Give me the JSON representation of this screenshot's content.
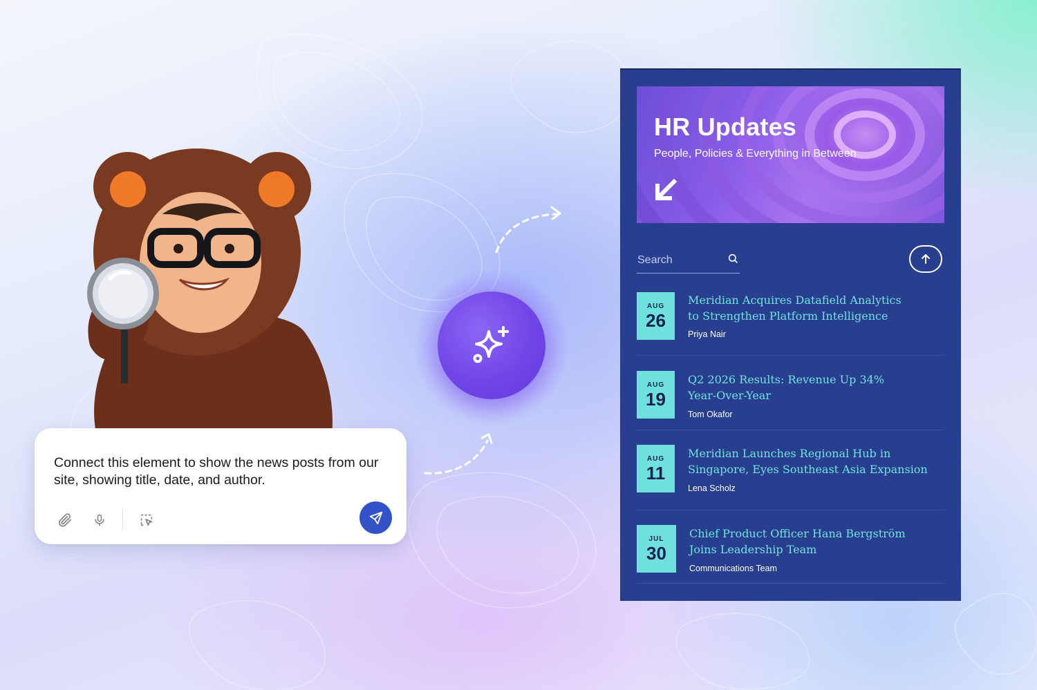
{
  "prompt": {
    "text": "Connect this element to show the news posts from our site, showing title, date, and author."
  },
  "icons": {
    "attach": "paperclip-icon",
    "mic": "microphone-icon",
    "select": "select-area-icon",
    "send": "send-icon",
    "ai": "sparkles-icon",
    "hero_arrow": "arrow-down-left-icon",
    "search": "search-icon",
    "up": "arrow-up-icon"
  },
  "colors": {
    "panel_bg": "#283e8f",
    "accent_teal": "#6fe0dd",
    "send_button": "#3452c8",
    "orb": "#7145e6"
  },
  "panel": {
    "hero": {
      "title": "HR Updates",
      "subtitle": "People, Policies & Everything in Between"
    },
    "search": {
      "placeholder": "Search"
    },
    "posts": [
      {
        "month": "AUG",
        "day": "26",
        "title_line1": "Meridian Acquires Datafield Analytics",
        "title_line2": "to Strengthen Platform Intelligence",
        "author": "Priya Nair"
      },
      {
        "month": "AUG",
        "day": "19",
        "title_line1": "Q2 2026 Results: Revenue Up 34%",
        "title_line2": "Year-Over-Year",
        "author": "Tom Okafor"
      },
      {
        "month": "AUG",
        "day": "11",
        "title_line1": "Meridian Launches Regional Hub in",
        "title_line2": "Singapore, Eyes Southeast Asia Expansion",
        "author": "Lena Scholz"
      },
      {
        "month": "JUL",
        "day": "30",
        "title_line1": "Chief Product Officer Hana Bergström",
        "title_line2": "Joins Leadership Team",
        "author": "Communications Team"
      }
    ]
  }
}
